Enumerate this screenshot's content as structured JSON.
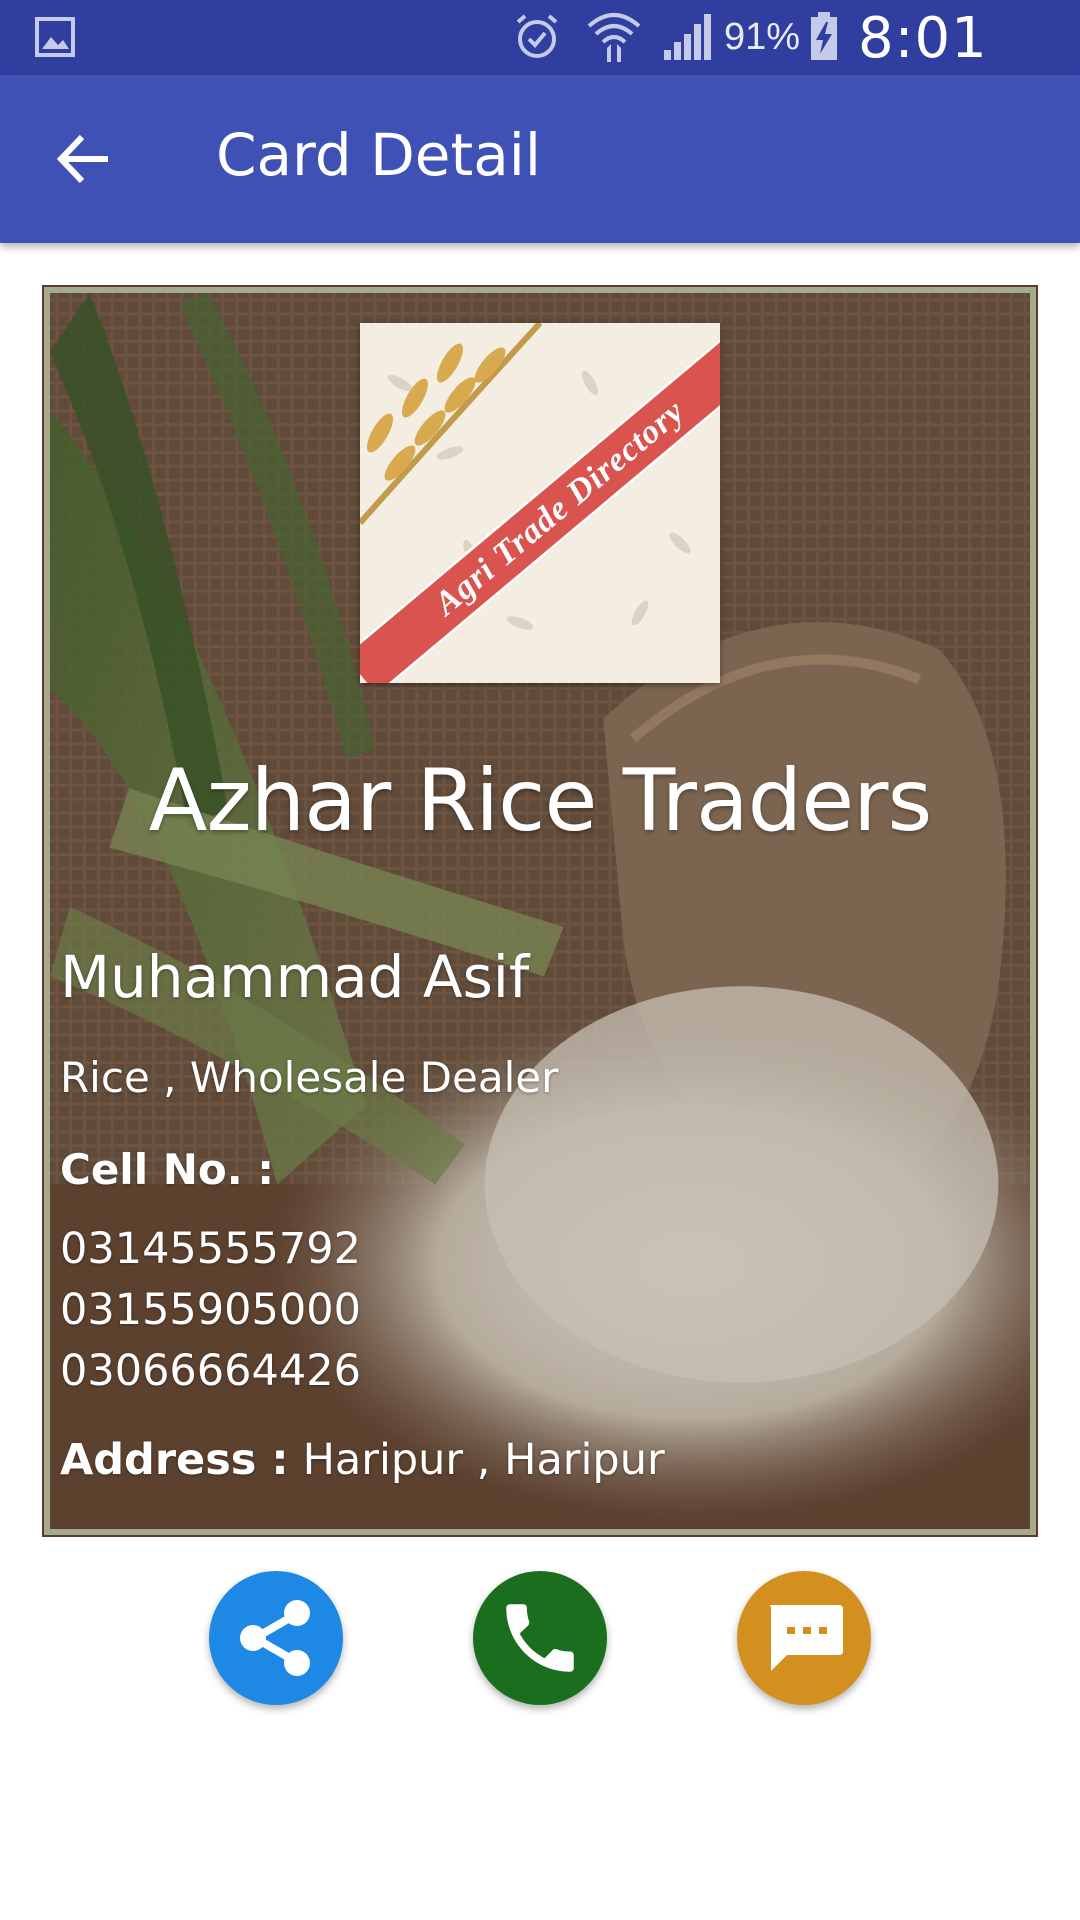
{
  "status_bar": {
    "battery_percent": "91%",
    "time": "8:01 PM",
    "icons": [
      "gallery-icon",
      "alarm-icon",
      "wifi-icon",
      "signal-icon",
      "battery-charging-icon"
    ]
  },
  "app_bar": {
    "title": "Card Detail",
    "back_icon": "arrow-back-icon"
  },
  "card": {
    "logo_text": "Agri Trade Directory",
    "company_name": "Azhar Rice Traders",
    "person_name": "Muhammad Asif",
    "business_type": "Rice , Wholesale Dealer",
    "cell_label": "Cell No. :",
    "phones": [
      "03145555792",
      "03155905000",
      "03066664426"
    ],
    "address_label": "Address :",
    "address_value": "Haripur , Haripur"
  },
  "actions": {
    "share_icon": "share-icon",
    "call_icon": "phone-icon",
    "message_icon": "message-icon"
  },
  "colors": {
    "status_bar": "#303f9f",
    "app_bar": "#3f51b5",
    "share": "#1e88e5",
    "call": "#1b6e1e",
    "message": "#d4901e"
  }
}
